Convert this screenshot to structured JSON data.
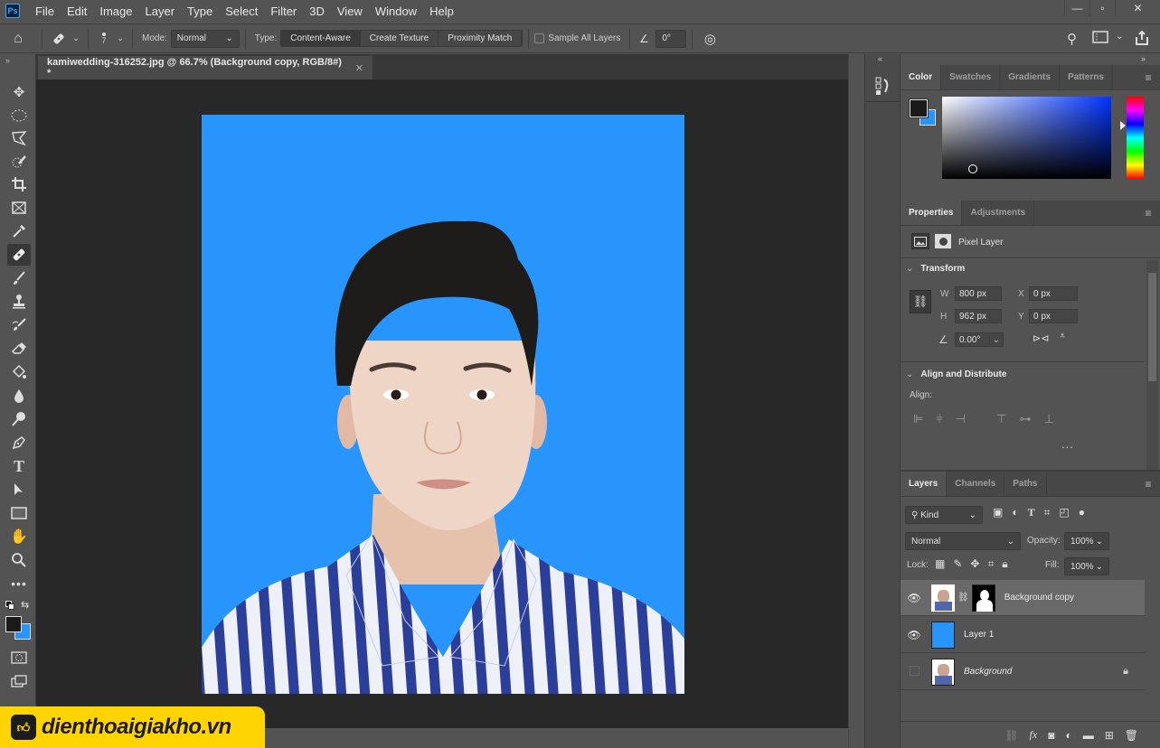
{
  "app": {
    "logo": "Ps"
  },
  "menu": [
    "File",
    "Edit",
    "Image",
    "Layer",
    "Type",
    "Select",
    "Filter",
    "3D",
    "View",
    "Window",
    "Help"
  ],
  "window_controls": {
    "minimize": "—",
    "restore": "▫",
    "close": "✕"
  },
  "options_bar": {
    "brush_size": "7",
    "mode_label": "Mode:",
    "mode_value": "Normal",
    "type_label": "Type:",
    "type_options": [
      "Content-Aware",
      "Create Texture",
      "Proximity Match"
    ],
    "type_selected": "Content-Aware",
    "sample_all_layers_label": "Sample All Layers",
    "sample_all_layers_checked": false,
    "angle_value": "0°"
  },
  "document": {
    "tab_title": "kamiwedding-316252.jpg @ 66.7% (Background copy, RGB/8#) *",
    "zoom": "66.7%",
    "background_color": "#2895fd"
  },
  "colors": {
    "foreground": "#1a1a1a",
    "background": "#2895fd",
    "accent": "#31a8ff"
  },
  "tools": [
    "move",
    "marquee-ellipse",
    "lasso-polygon",
    "quick-selection",
    "crop",
    "frame",
    "eyedropper",
    "spot-healing-brush",
    "brush",
    "clone-stamp",
    "history-brush",
    "eraser",
    "paint-bucket",
    "blur",
    "dodge",
    "pen",
    "type",
    "path-selection",
    "rectangle",
    "hand",
    "zoom",
    "more"
  ],
  "selected_tool": "spot-healing-brush",
  "color_panel": {
    "tabs": [
      "Color",
      "Swatches",
      "Gradients",
      "Patterns"
    ],
    "active": "Color"
  },
  "properties_panel": {
    "tabs": [
      "Properties",
      "Adjustments"
    ],
    "active": "Properties",
    "kind": "Pixel Layer",
    "transform_title": "Transform",
    "w_label": "W",
    "w": "800 px",
    "h_label": "H",
    "h": "962 px",
    "x_label": "X",
    "x": "0 px",
    "y_label": "Y",
    "y": "0 px",
    "angle": "0.00°",
    "align_title": "Align and Distribute",
    "align_label": "Align:",
    "more": "..."
  },
  "layers_panel": {
    "tabs": [
      "Layers",
      "Channels",
      "Paths"
    ],
    "active": "Layers",
    "filter": "Kind",
    "blend_mode": "Normal",
    "opacity_label": "Opacity:",
    "opacity": "100%",
    "lock_label": "Lock:",
    "fill_label": "Fill:",
    "fill": "100%",
    "layers": [
      {
        "name": "Background copy",
        "visible": true,
        "selected": true,
        "has_mask": true
      },
      {
        "name": "Layer 1",
        "visible": true,
        "selected": false,
        "has_mask": false
      },
      {
        "name": "Background",
        "visible": false,
        "selected": false,
        "locked": true,
        "italic": true
      }
    ]
  },
  "watermark": {
    "text": "dienthoaigiakho.vn"
  }
}
